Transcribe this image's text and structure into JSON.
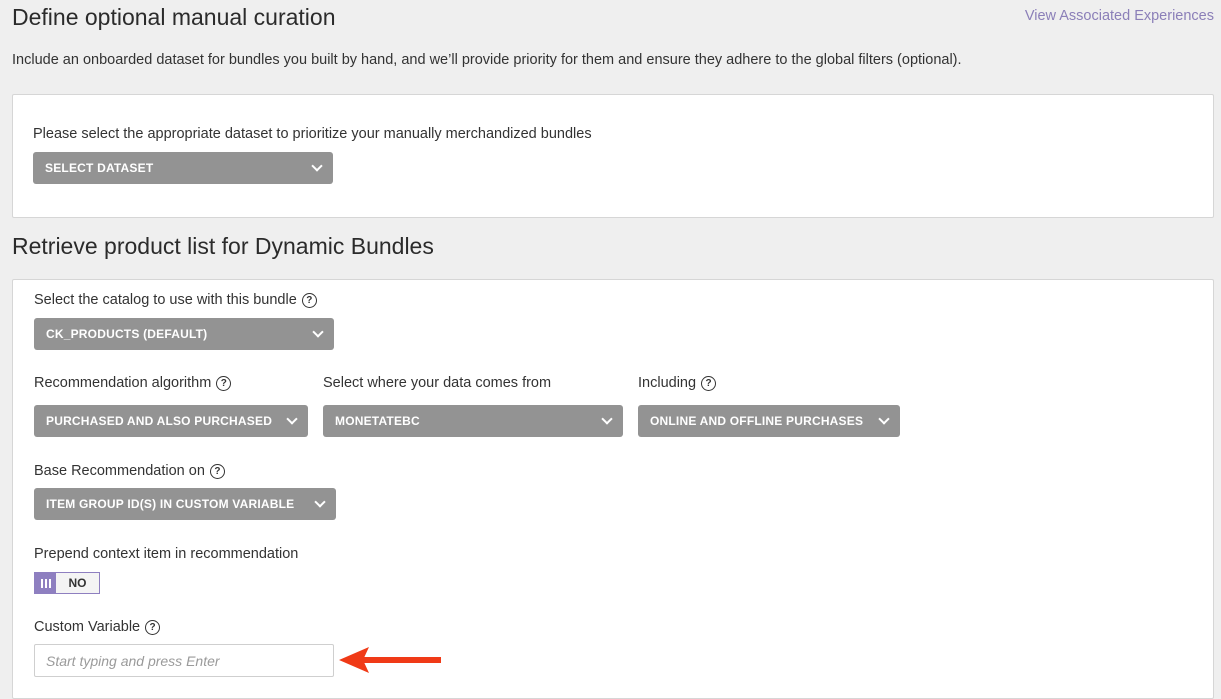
{
  "header": {
    "title": "Define optional manual curation",
    "link": "View Associated Experiences",
    "description": "Include an onboarded dataset for bundles you built by hand, and we’ll provide priority for them and ensure they adhere to the global filters (optional)."
  },
  "curation": {
    "label": "Please select the appropriate dataset to prioritize your manually merchandized bundles",
    "dropdown": "SELECT DATASET"
  },
  "retrieve": {
    "title": "Retrieve product list for Dynamic Bundles",
    "catalog": {
      "label": "Select the catalog to use with this bundle",
      "value": "CK_PRODUCTS (DEFAULT)"
    },
    "algorithm": {
      "label": "Recommendation algorithm",
      "value": "PURCHASED AND ALSO PURCHASED"
    },
    "source": {
      "label": "Select where your data comes from",
      "value": "MONETATEBC"
    },
    "including": {
      "label": "Including",
      "value": "ONLINE AND OFFLINE PURCHASES"
    },
    "base": {
      "label": "Base Recommendation on",
      "value": "ITEM GROUP ID(S) IN CUSTOM VARIABLE"
    },
    "prepend": {
      "label": "Prepend context item in recommendation",
      "toggle": "NO"
    },
    "custom_variable": {
      "label": "Custom Variable",
      "placeholder": "Start typing and press Enter"
    }
  },
  "help_glyph": "?",
  "colors": {
    "accent": "#8e7fc0",
    "dropdown": "#939393",
    "arrow": "#f03a17"
  },
  "icons": {
    "help": "help-circle-icon",
    "chevron": "chevron-down-icon",
    "arrow": "arrow-left-icon"
  }
}
